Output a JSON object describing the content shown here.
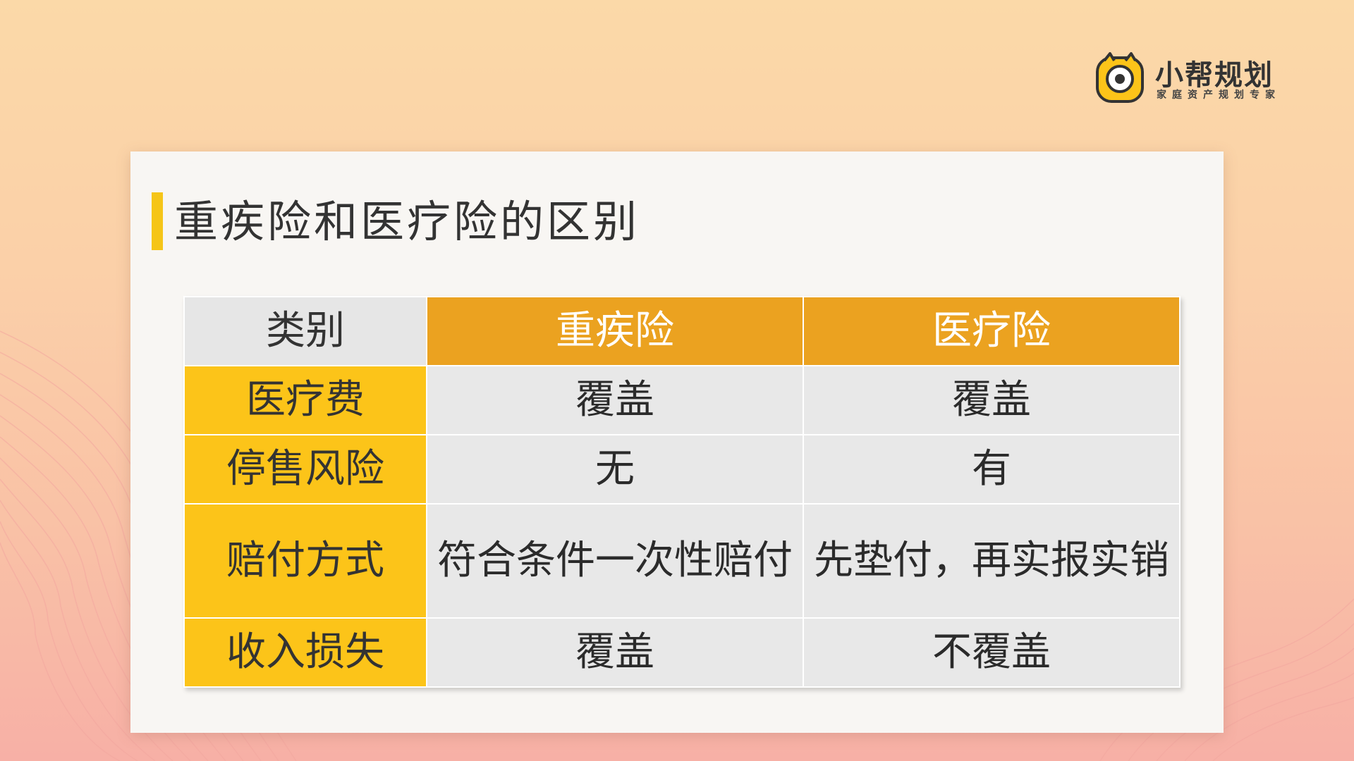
{
  "logo": {
    "name": "小帮规划",
    "tagline": "家庭资产规划专家"
  },
  "slide": {
    "title": "重疾险和医疗险的区别"
  },
  "table": {
    "corner": "类别",
    "columns": [
      "重疾险",
      "医疗险"
    ],
    "rows": [
      {
        "label": "医疗费",
        "cells": [
          "覆盖",
          "覆盖"
        ]
      },
      {
        "label": "停售风险",
        "cells": [
          "无",
          "有"
        ]
      },
      {
        "label": "赔付方式",
        "cells": [
          "符合条件一次性赔付",
          "先垫付，再实报实销"
        ]
      },
      {
        "label": "收入损失",
        "cells": [
          "覆盖",
          "不覆盖"
        ]
      }
    ]
  },
  "colors": {
    "accent_yellow": "#fcc419",
    "header_orange": "#eba220",
    "cell_gray": "#e8e8e8"
  }
}
